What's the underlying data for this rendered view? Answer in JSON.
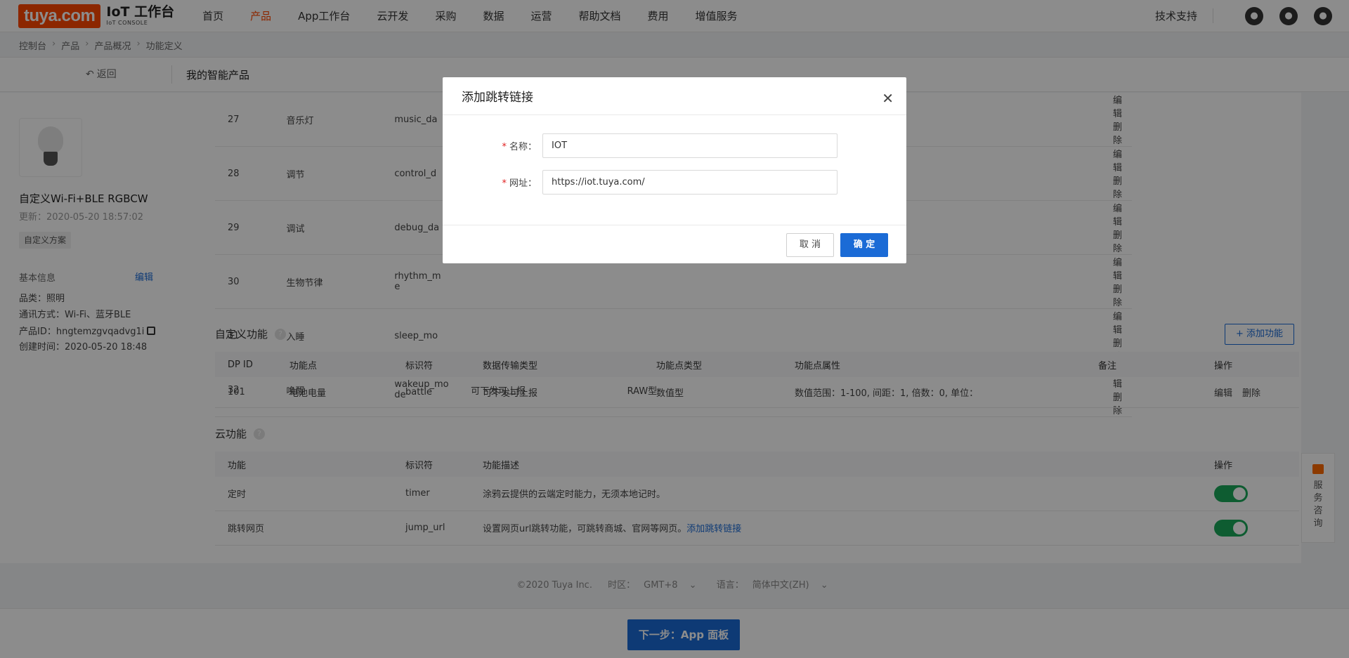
{
  "nav": {
    "logo_text": "tuya.com",
    "logo_title": "IoT 工作台",
    "logo_sub": "IoT CONSOLE",
    "items": [
      "首页",
      "产品",
      "App工作台",
      "云开发",
      "采购",
      "数据",
      "运营",
      "帮助文档",
      "费用",
      "增值服务"
    ],
    "active_index": 1,
    "support": "技术支持",
    "icons": [
      "bell-icon",
      "globe-icon",
      "user-icon"
    ]
  },
  "breadcrumb": [
    "控制台",
    "产品",
    "产品概况",
    "功能定义"
  ],
  "subheader": {
    "back": "返回",
    "title": "我的智能产品"
  },
  "product": {
    "name": "自定义Wi-Fi+BLE RGBCW",
    "updated": "更新：2020-05-20 18:57:02",
    "tag": "自定义方案",
    "basic_title": "基本信息",
    "basic_edit": "编辑",
    "category": "品类：照明",
    "protocol": "通讯方式：Wi-Fi、蓝牙BLE",
    "pid": "产品ID：hngtemzgvqadvg1i",
    "created": "创建时间：2020-05-20 18:48"
  },
  "dp_rows": [
    {
      "id": "27",
      "name": "音乐灯",
      "code": "music_da",
      "trans": "",
      "type": ""
    },
    {
      "id": "28",
      "name": "调节",
      "code": "control_d",
      "trans": "",
      "type": ""
    },
    {
      "id": "29",
      "name": "调试",
      "code": "debug_da",
      "trans": "",
      "type": ""
    },
    {
      "id": "30",
      "name": "生物节律",
      "code": "rhythm_m\ne",
      "trans": "",
      "type": ""
    },
    {
      "id": "31",
      "name": "入睡",
      "code": "sleep_mo",
      "trans": "",
      "type": ""
    },
    {
      "id": "32",
      "name": "唤醒",
      "code": "wakeup_mo\nde",
      "trans": "可下发可上报",
      "type": "RAW型"
    }
  ],
  "ops": {
    "edit": "编辑",
    "delete": "删除"
  },
  "custom": {
    "title": "自定义功能",
    "add_button": "+ 添加功能",
    "headers": [
      "DP ID",
      "功能点",
      "标识符",
      "数据传输类型",
      "功能点类型",
      "功能点属性",
      "备注",
      "操作"
    ],
    "rows": [
      {
        "id": "101",
        "name": "电池电量",
        "code": "battle",
        "trans": "可下发可上报",
        "type": "数值型",
        "attr": "数值范围：1-100, 间距：1, 倍数：0, 单位：",
        "note": ""
      }
    ]
  },
  "cloud": {
    "title": "云功能",
    "headers": [
      "功能",
      "标识符",
      "功能描述",
      "操作"
    ],
    "rows": [
      {
        "name": "定时",
        "code": "timer",
        "desc": "涂鸦云提供的云端定时能力，无须本地记时。",
        "link": "",
        "enabled": true
      },
      {
        "name": "跳转网页",
        "code": "jump_url",
        "desc": "设置网页url跳转功能，可跳转商城、官网等网页。",
        "link": "添加跳转链接",
        "enabled": true
      }
    ]
  },
  "consult": {
    "label": "服务咨询"
  },
  "footer": {
    "copyright": "©2020 Tuya Inc.",
    "tz_label": "时区：",
    "tz": "GMT+8",
    "lang_label": "语言：",
    "lang": "简体中文(ZH)"
  },
  "next_button": "下一步：App 面板",
  "modal": {
    "title": "添加跳转链接",
    "name_label": "名称：",
    "name_value": "IOT",
    "url_label": "网址：",
    "url_value": "https://iot.tuya.com/",
    "cancel": "取 消",
    "ok": "确 定"
  },
  "colors": {
    "brand": "#ff4800",
    "primary": "#1b6bd6",
    "toggle_on": "#1aa85a"
  }
}
